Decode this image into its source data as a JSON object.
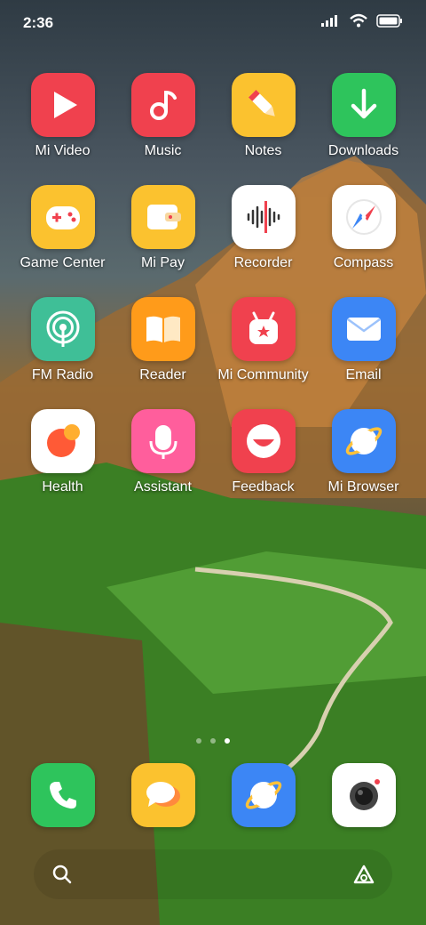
{
  "status": {
    "time": "2:36"
  },
  "apps": [
    {
      "label": "Mi Video",
      "icon": "play-icon",
      "bg": "#f0414e"
    },
    {
      "label": "Music",
      "icon": "music-note-icon",
      "bg": "#f0414e"
    },
    {
      "label": "Notes",
      "icon": "pencil-icon",
      "bg": "#fbc22f"
    },
    {
      "label": "Downloads",
      "icon": "download-arrow-icon",
      "bg": "#2ec45c"
    },
    {
      "label": "Game Center",
      "icon": "gamepad-icon",
      "bg": "#fbc22f"
    },
    {
      "label": "Mi Pay",
      "icon": "wallet-icon",
      "bg": "#fbc22f"
    },
    {
      "label": "Recorder",
      "icon": "waveform-icon",
      "bg": "#ffffff"
    },
    {
      "label": "Compass",
      "icon": "compass-icon",
      "bg": "#ffffff"
    },
    {
      "label": "FM Radio",
      "icon": "radio-icon",
      "bg": "#3fbf97"
    },
    {
      "label": "Reader",
      "icon": "book-icon",
      "bg": "#ff9b1a"
    },
    {
      "label": "Mi Community",
      "icon": "mi-bunny-icon",
      "bg": "#f0414e"
    },
    {
      "label": "Email",
      "icon": "envelope-icon",
      "bg": "#3c86f5"
    },
    {
      "label": "Health",
      "icon": "health-circle-icon",
      "bg": "#ffffff"
    },
    {
      "label": "Assistant",
      "icon": "microphone-icon",
      "bg": "#ff5e9c"
    },
    {
      "label": "Feedback",
      "icon": "smile-icon",
      "bg": "#f0414e"
    },
    {
      "label": "Mi Browser",
      "icon": "planet-icon",
      "bg": "#3c86f5"
    }
  ],
  "dock": [
    {
      "icon": "phone-icon",
      "bg": "#2ec45c"
    },
    {
      "icon": "message-icon",
      "bg": "#fbc22f"
    },
    {
      "icon": "planet-icon",
      "bg": "#3c86f5"
    },
    {
      "icon": "camera-icon",
      "bg": "#ffffff"
    }
  ],
  "page_indicator": {
    "count": 3,
    "active": 3
  }
}
